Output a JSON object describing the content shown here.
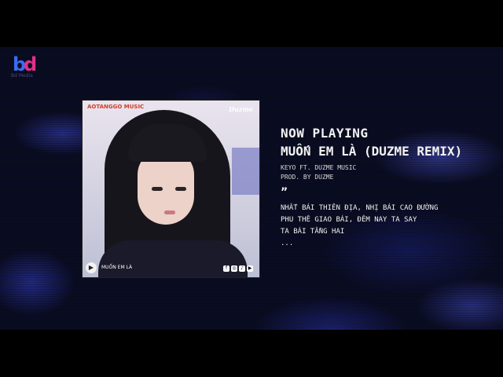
{
  "brand": {
    "logo_letters": "bd",
    "logo_sub": "Bd Media"
  },
  "cover": {
    "label_left": "AOTANGGO MUSIC",
    "label_right": "Duzme",
    "play_icon": "play-icon",
    "mini_title": "MUỐN EM LÀ",
    "social_icons": [
      "facebook-icon",
      "instagram-icon",
      "tiktok-icon",
      "youtube-icon"
    ]
  },
  "player": {
    "status": "NOW PLAYING",
    "title": "MUỐN EM LÀ (DUZME REMIX)",
    "artist": "KEYO FT. DUZME MUSIC",
    "producer": "PROD. BY DUZME",
    "quote_mark": "”"
  },
  "lyrics": [
    "NHẤT BÁI THIÊN ĐỊA, NHỊ BÁI CAO ĐƯỜNG",
    "PHU THÊ GIAO BÁI, ĐÊM NAY TA SAY",
    "TA BÁI TẦNG HAI",
    "..."
  ],
  "colors": {
    "background": "#0a0c22",
    "logo_b": "#3a6cf0",
    "logo_d": "#e0308a",
    "text": "#f2f2f2"
  }
}
